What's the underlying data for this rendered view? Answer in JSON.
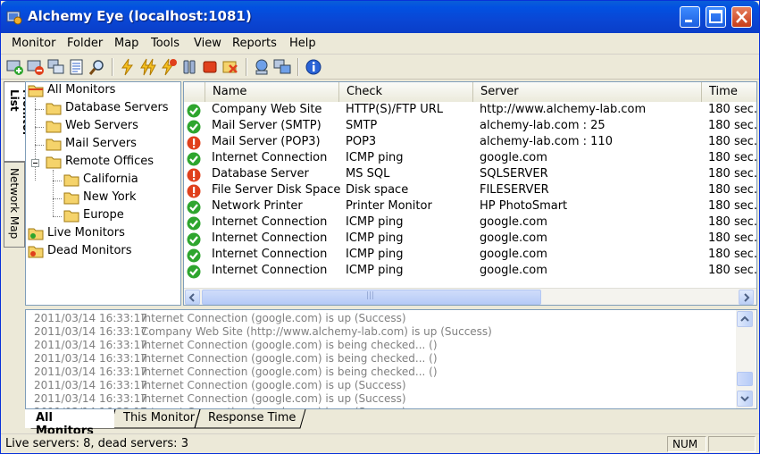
{
  "window": {
    "title": "Alchemy Eye (localhost:1081)"
  },
  "menu": [
    "Monitor",
    "Folder",
    "Map",
    "Tools",
    "View",
    "Reports",
    "Help"
  ],
  "toolbar_icons": [
    "add-monitor-icon",
    "remove-monitor-icon",
    "copy-monitor-icon",
    "properties-icon",
    "find-icon",
    "check-icon",
    "check-all-icon",
    "check-dead-icon",
    "pause-icon",
    "stop-icon",
    "clear-icon",
    "connect-icon",
    "remote-icon",
    "info-icon"
  ],
  "side_tabs": {
    "monitor_list": "Monitor List",
    "network_map": "Network Map"
  },
  "tree": [
    {
      "label": "All Monitors",
      "level": 0
    },
    {
      "label": "Database Servers",
      "level": 1
    },
    {
      "label": "Web Servers",
      "level": 1
    },
    {
      "label": "Mail Servers",
      "level": 1
    },
    {
      "label": "Remote Offices",
      "level": 1
    },
    {
      "label": "California",
      "level": 2
    },
    {
      "label": "New York",
      "level": 2
    },
    {
      "label": "Europe",
      "level": 2
    },
    {
      "label": "Live Monitors",
      "level": 0
    },
    {
      "label": "Dead Monitors",
      "level": 0
    }
  ],
  "grid": {
    "columns": [
      "Name",
      "Check",
      "Server",
      "Time"
    ],
    "rows": [
      {
        "status": "up",
        "name": "Company Web Site",
        "check": "HTTP(S)/FTP URL",
        "server": "http://www.alchemy-lab.com",
        "time": "180 sec."
      },
      {
        "status": "up",
        "name": "Mail Server (SMTP)",
        "check": "SMTP",
        "server": "alchemy-lab.com : 25",
        "time": "180 sec."
      },
      {
        "status": "down",
        "name": "Mail Server (POP3)",
        "check": "POP3",
        "server": "alchemy-lab.com : 110",
        "time": "180 sec."
      },
      {
        "status": "up",
        "name": "Internet Connection",
        "check": "ICMP ping",
        "server": "google.com",
        "time": "180 sec."
      },
      {
        "status": "down",
        "name": "Database Server",
        "check": "MS SQL",
        "server": "SQLSERVER",
        "time": "180 sec."
      },
      {
        "status": "down",
        "name": "File Server Disk Space",
        "check": "Disk space",
        "server": "FILESERVER",
        "time": "180 sec."
      },
      {
        "status": "up",
        "name": "Network Printer",
        "check": "Printer Monitor",
        "server": "HP PhotoSmart",
        "time": "180 sec."
      },
      {
        "status": "up",
        "name": "Internet Connection",
        "check": "ICMP ping",
        "server": "google.com",
        "time": "180 sec."
      },
      {
        "status": "up",
        "name": "Internet Connection",
        "check": "ICMP ping",
        "server": "google.com",
        "time": "180 sec."
      },
      {
        "status": "up",
        "name": "Internet Connection",
        "check": "ICMP ping",
        "server": "google.com",
        "time": "180 sec."
      },
      {
        "status": "up",
        "name": "Internet Connection",
        "check": "ICMP ping",
        "server": "google.com",
        "time": "180 sec."
      }
    ],
    "scroll_thumb_mark": "|||"
  },
  "log": [
    {
      "time": "2011/03/14 16:33:17",
      "message": "Internet Connection (google.com) is up (Success)"
    },
    {
      "time": "2011/03/14 16:33:17",
      "message": "Company Web Site (http://www.alchemy-lab.com) is up (Success)"
    },
    {
      "time": "2011/03/14 16:33:17",
      "message": "Internet Connection (google.com) is being checked... ()"
    },
    {
      "time": "2011/03/14 16:33:17",
      "message": "Internet Connection (google.com) is being checked... ()"
    },
    {
      "time": "2011/03/14 16:33:17",
      "message": "Internet Connection (google.com) is being checked... ()"
    },
    {
      "time": "2011/03/14 16:33:17",
      "message": "Internet Connection (google.com) is up (Success)"
    },
    {
      "time": "2011/03/14 16:33:17",
      "message": "Internet Connection (google.com) is up (Success)"
    },
    {
      "time": "2011/03/14 16:33:17",
      "message": "Internet Connection (google.com) is up (Success)"
    }
  ],
  "bottom_tabs": [
    "All Monitors",
    "This Monitor",
    "Response Time"
  ],
  "status": {
    "main": "Live servers: 8, dead servers: 3",
    "num": "NUM"
  },
  "colors": {
    "title_bar": "#0a46d4",
    "status_up": "#2ea52e",
    "status_down": "#e0401c",
    "folder": "#f5d36b"
  }
}
